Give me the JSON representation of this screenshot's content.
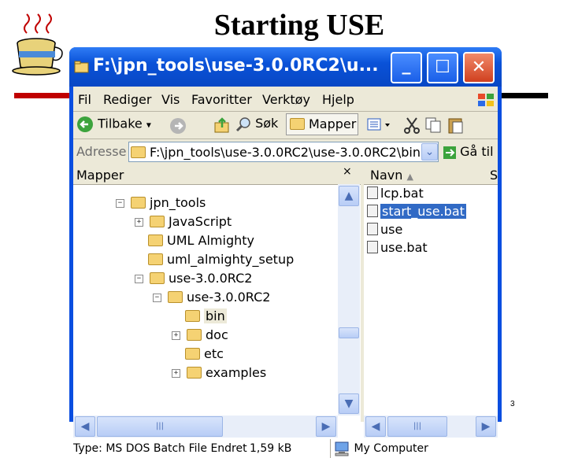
{
  "slide": {
    "title": "Starting USE",
    "page_number": "3"
  },
  "window": {
    "title": "F:\\jpn_tools\\use-3.0.0RC2\\u...",
    "minimize_glyph": "_",
    "maximize_glyph": "☐",
    "close_glyph": "✕"
  },
  "menubar": {
    "items": [
      "Fil",
      "Rediger",
      "Vis",
      "Favoritter",
      "Verktøy",
      "Hjelp"
    ]
  },
  "toolbar": {
    "back_label": "Tilbake",
    "search_label": "Søk",
    "folders_label": "Mapper"
  },
  "address": {
    "label": "Adresse",
    "value": "F:\\jpn_tools\\use-3.0.0RC2\\use-3.0.0RC2\\bin",
    "go_label": "Gå til"
  },
  "folders_panel": {
    "header": "Mapper",
    "close_glyph": "×",
    "items": [
      {
        "label": "jpn_tools",
        "expander": "−"
      },
      {
        "label": "JavaScript",
        "expander": "+"
      },
      {
        "label": "UML Almighty",
        "expander": ""
      },
      {
        "label": "uml_almighty_setup",
        "expander": ""
      },
      {
        "label": "use-3.0.0RC2",
        "expander": "−"
      },
      {
        "label": "use-3.0.0RC2",
        "expander": "−"
      },
      {
        "label": "bin",
        "expander": ""
      },
      {
        "label": "doc",
        "expander": "+"
      },
      {
        "label": "etc",
        "expander": ""
      },
      {
        "label": "examples",
        "expander": "+"
      }
    ]
  },
  "files_panel": {
    "header_name": "Navn",
    "header_second": "S",
    "files": [
      "lcp.bat",
      "start_use.bat",
      "use",
      "use.bat"
    ],
    "selected_file": "start_use.bat"
  },
  "statusbar": {
    "type_text": "Type: MS DOS Batch File Endret da",
    "size_text": "1,59 kB",
    "location_text": "My Computer"
  },
  "colors": {
    "titlebar": "#0a52d8",
    "selection": "#316ac5",
    "slide_accent": "#c00000"
  }
}
